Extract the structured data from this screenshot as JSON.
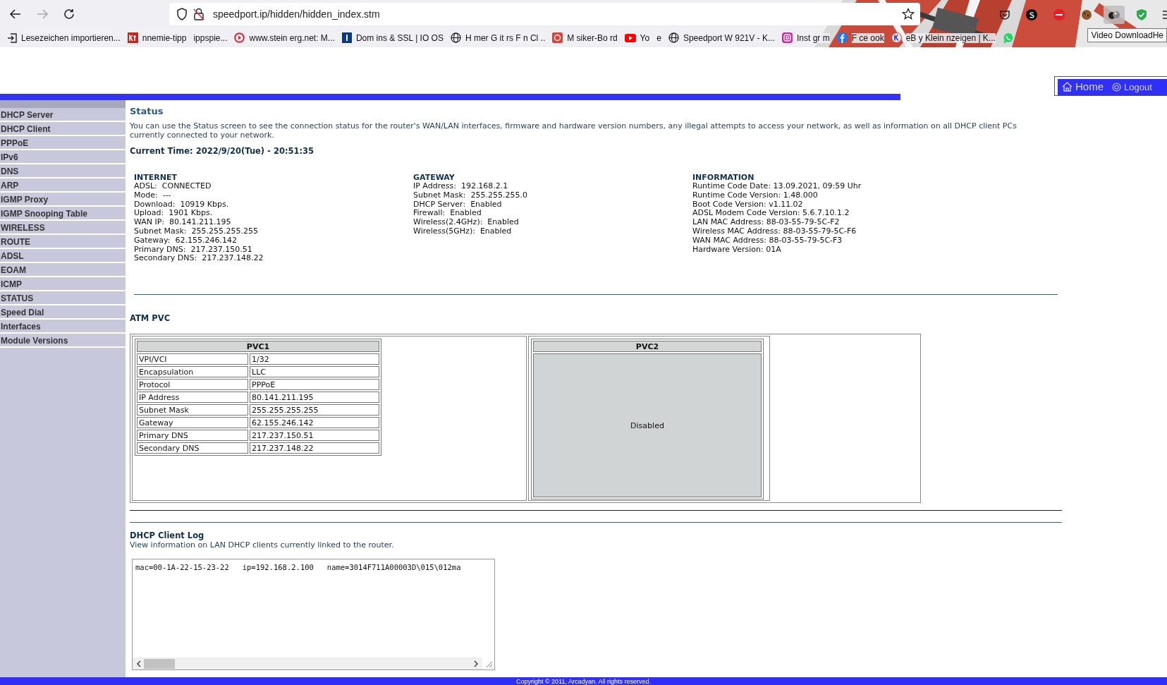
{
  "browser": {
    "back": {
      "disabled": false
    },
    "forward": {
      "disabled": true
    },
    "url": "speedport.ip/hidden/hidden_index.stm",
    "tooltip": "Video DownloadHe",
    "bookmarks": [
      {
        "label": "Lesezeichen importieren..."
      },
      {
        "label": "nnemie-tipp"
      },
      {
        "label": "ippspie..."
      },
      {
        "label": "www.stein erg.net: M..."
      },
      {
        "label": "Dom ins & SSL | IO OS"
      },
      {
        "label": "H mer G it rs F n Cl .."
      },
      {
        "label": "M siker-Bo rd"
      },
      {
        "label": "Yo   e"
      },
      {
        "label": "Speedport W 921V - K..."
      },
      {
        "label": "Inst gr m"
      },
      {
        "label": "F ce ook"
      },
      {
        "label": "eB y Klein nzeigen | K..."
      }
    ]
  },
  "header_nav": [
    {
      "label": "Home"
    },
    {
      "label": "Logout"
    }
  ],
  "sidebar": {
    "items": [
      {
        "label": "DHCP Server"
      },
      {
        "label": "DHCP Client"
      },
      {
        "label": "PPPoE"
      },
      {
        "label": "IPv6"
      },
      {
        "label": "DNS"
      },
      {
        "label": "ARP"
      },
      {
        "label": "IGMP Proxy"
      },
      {
        "label": "IGMP Snooping Table"
      },
      {
        "label": "WIRELESS"
      },
      {
        "label": "ROUTE"
      },
      {
        "label": "ADSL"
      },
      {
        "label": "EOAM"
      },
      {
        "label": "ICMP"
      },
      {
        "label": "STATUS"
      },
      {
        "label": "Speed Dial"
      },
      {
        "label": "Interfaces"
      },
      {
        "label": "Module Versions"
      }
    ]
  },
  "status": {
    "title": "Status",
    "description": "You can use the Status screen to see the connection status for the router's WAN/LAN interfaces, firmware and hardware version numbers, any illegal attempts to access your network, as well as information on all DHCP client PCs currently connected to your network.",
    "current_time": "Current Time: 2022/9/20(Tue) - 20:51:35",
    "sections": [
      {
        "title": "INTERNET",
        "lines": [
          "ADSL:  CONNECTED",
          "Mode:  ---",
          "Download:  10919 Kbps.",
          "Upload:  1901 Kbps.",
          "WAN IP:  80.141.211.195",
          "Subnet Mask:  255.255.255.255",
          "Gateway:  62.155.246.142",
          "Primary DNS:  217.237.150.51",
          "Secondary DNS:  217.237.148.22"
        ]
      },
      {
        "title": "GATEWAY",
        "lines": [
          "IP Address:  192.168.2.1",
          "Subnet Mask:  255.255.255.0",
          "DHCP Server:  Enabled",
          "Firewall:  Enabled",
          "Wireless(2.4GHz):  Enabled",
          "Wireless(5GHz):  Enabled"
        ]
      },
      {
        "title": "INFORMATION",
        "lines": [
          "Runtime Code Date: 13.09.2021, 09:59 Uhr",
          "Runtime Code Version: 1.48.000",
          "Boot Code Version: v1.11.02",
          "ADSL Modem Code Version: 5.6.7.10.1.2",
          "LAN MAC Address: 88-03-55-79-5C-F2",
          "Wireless MAC Address: 88-03-55-79-5C-F6",
          "WAN MAC Address: 88-03-55-79-5C-F3",
          "Hardware Version: 01A"
        ]
      }
    ]
  },
  "atm_pvc": {
    "title": "ATM PVC",
    "pvcs": [
      {
        "title": "PVC1",
        "kind": "table",
        "rows": [
          {
            "label": "VPI/VCI",
            "value": "1/32"
          },
          {
            "label": "Encapsulation",
            "value": "LLC"
          },
          {
            "label": "Protocol",
            "value": "PPPoE"
          },
          {
            "label": "IP Address",
            "value": "80.141.211.195"
          },
          {
            "label": "Subnet Mask",
            "value": "255.255.255.255"
          },
          {
            "label": "Gateway",
            "value": "62.155.246.142"
          },
          {
            "label": "Primary DNS",
            "value": "217.237.150.51"
          },
          {
            "label": "Secondary DNS",
            "value": "217.237.148.22"
          }
        ]
      },
      {
        "title": "PVC2",
        "kind": "disabled",
        "status": "Disabled"
      }
    ]
  },
  "dhcp_log": {
    "title": "DHCP Client Log",
    "description": "View information on LAN DHCP clients currently linked to the router.",
    "entries": [
      "mac=00-1A-22-15-23-22   ip=192.168.2.100   name=3014F711A00003D\\015\\012ma"
    ]
  },
  "footer": "Copyright © 2011, Arcadyan. All rights reserved."
}
